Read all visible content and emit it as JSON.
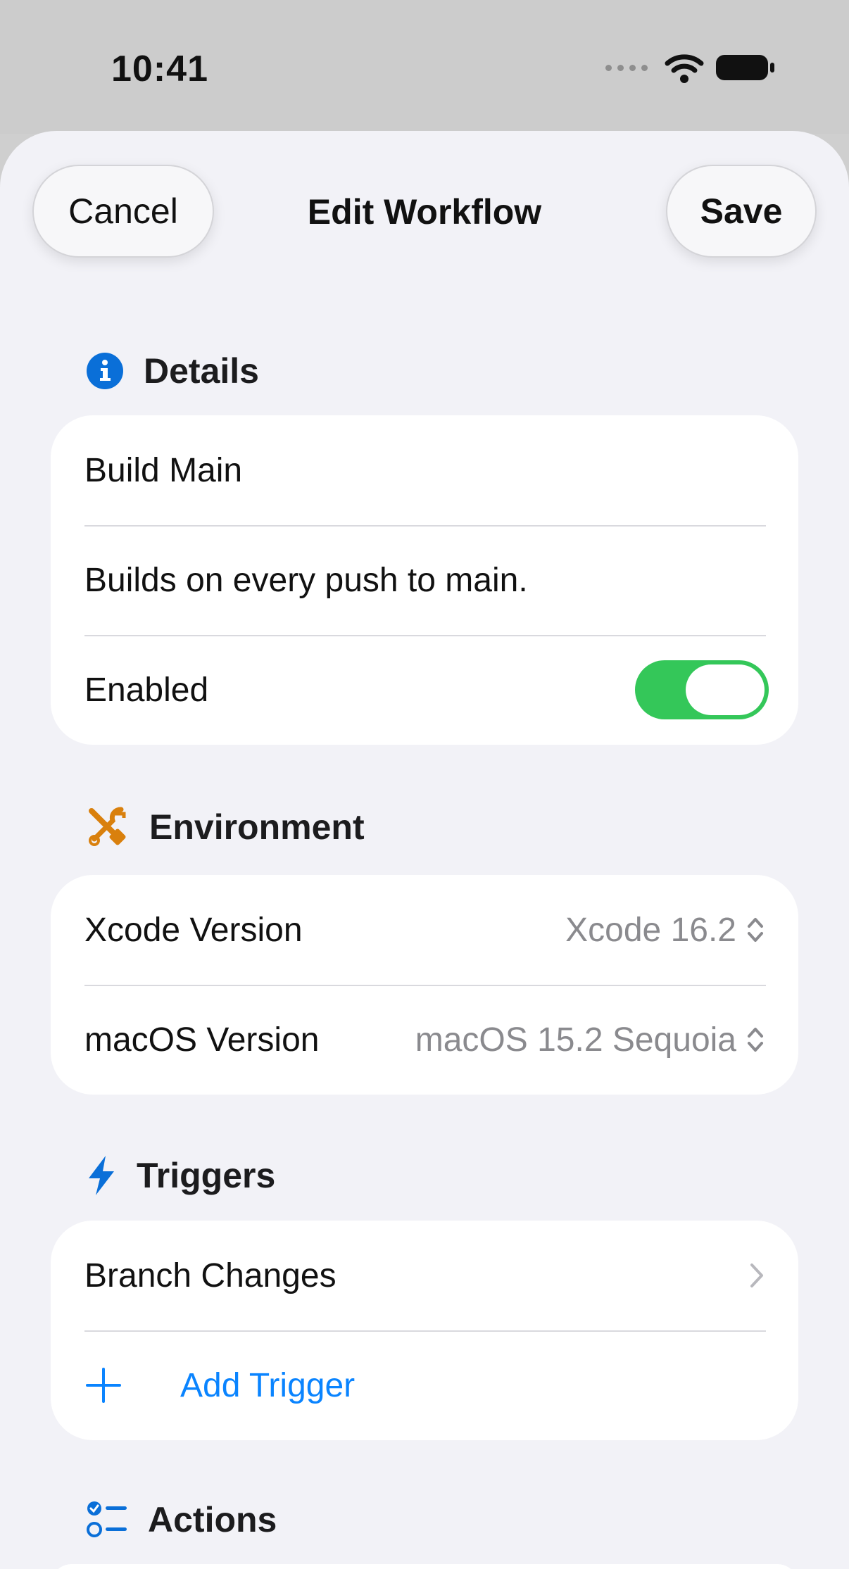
{
  "status_bar": {
    "time": "10:41"
  },
  "nav": {
    "cancel_label": "Cancel",
    "title": "Edit Workflow",
    "save_label": "Save"
  },
  "details": {
    "header": "Details",
    "icon": "info-icon",
    "name_value": "Build Main",
    "description_value": "Builds on every push to main.",
    "enabled_label": "Enabled",
    "enabled": true
  },
  "environment": {
    "header": "Environment",
    "icon": "tools-icon",
    "xcode_label": "Xcode Version",
    "xcode_value": "Xcode 16.2",
    "macos_label": "macOS Version",
    "macos_value": "macOS 15.2 Sequoia"
  },
  "triggers": {
    "header": "Triggers",
    "icon": "bolt-icon",
    "items": [
      {
        "label": "Branch Changes"
      }
    ],
    "add_label": "Add Trigger"
  },
  "actions": {
    "header": "Actions",
    "icon": "checklist-icon"
  },
  "colors": {
    "accent": "#0a84ff",
    "toggle_on": "#34c759",
    "environment_icon": "#d9800d"
  }
}
